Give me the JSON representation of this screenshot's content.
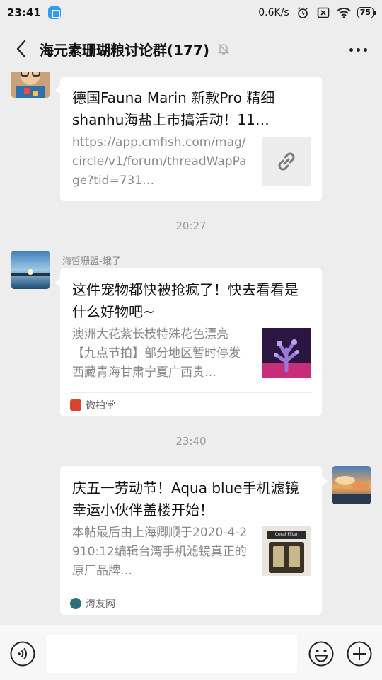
{
  "status_bar": {
    "time": "23:41",
    "net_speed": "0.6K/s",
    "battery": "75"
  },
  "header": {
    "title": "海元素珊瑚粮讨论群(177)"
  },
  "messages": [
    {
      "title": "德国Fauna Marin 新款Pro 精细shanhu海盐上市搞活动！11…",
      "desc": "https://app.cmfish.com/mag/circle/v1/forum/threadWapPage?tid=731…",
      "thumb_icon": "link-icon"
    },
    {
      "timestamp": "20:27",
      "sender": "海皙珊盟-蛾子",
      "title": "这件宠物都快被抢疯了！快去看看是什么好物吧~",
      "desc": "澳洲大花紫长枝特殊花色漂亮【九点节拍】部分地区暂时停发西藏青海甘肃宁夏广西贵…",
      "source": "微拍堂"
    },
    {
      "timestamp": "23:40",
      "title": "庆五一劳动节！Aqua blue手机滤镜幸运小伙伴盖楼开始！",
      "desc": "本帖最后由上海卿顺于2020-4-2910:12编辑台湾手机滤镜真正的原厂品牌…",
      "thumb_label": "Coral Filter",
      "source": "海友网"
    }
  ],
  "input": {
    "placeholder": ""
  },
  "colors": {
    "background": "#ededed",
    "card": "#ffffff",
    "muted_text": "#888888"
  }
}
